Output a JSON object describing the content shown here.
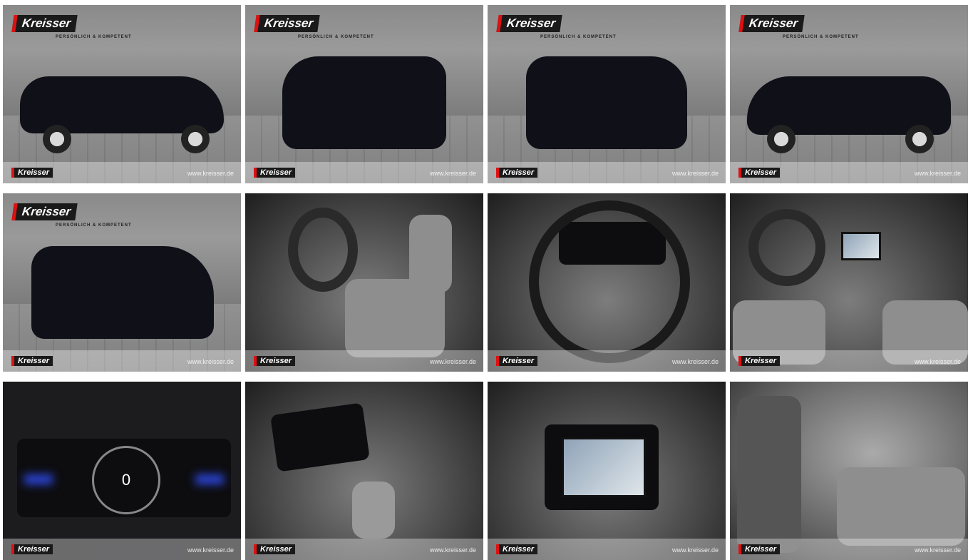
{
  "brand": {
    "logo_text": "Kreisser",
    "tagline": "PERSÖNLICH & KOMPETENT",
    "accent_color": "#d11111"
  },
  "gallery": {
    "tiles": [
      {
        "logo_top": true,
        "url": "www.kreisser.de"
      },
      {
        "logo_top": true,
        "url": "www.kreisser.de"
      },
      {
        "logo_top": true,
        "url": "www.kreisser.de"
      },
      {
        "logo_top": true,
        "url": "www.kreisser.de"
      },
      {
        "logo_top": true,
        "url": "www.kreisser.de"
      },
      {
        "logo_top": false,
        "url": "www.kreisser.de"
      },
      {
        "logo_top": false,
        "url": "www.kreisser.de"
      },
      {
        "logo_top": false,
        "url": "www.kreisser.de"
      },
      {
        "logo_top": false,
        "url": "www.kreisser.de"
      },
      {
        "logo_top": false,
        "url": "www.kreisser.de"
      },
      {
        "logo_top": false,
        "url": "www.kreisser.de"
      },
      {
        "logo_top": false,
        "url": "www.kreisser.de"
      }
    ],
    "speed_display": "0"
  }
}
